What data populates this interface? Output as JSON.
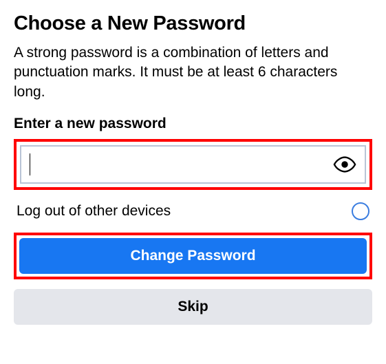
{
  "header": {
    "title": "Choose a New Password",
    "description": "A strong password is a combination of letters and punctuation marks. It must be at least 6 characters long."
  },
  "form": {
    "passwordLabel": "Enter a new password",
    "passwordValue": "",
    "logoutOthersLabel": "Log out of other devices",
    "logoutOthersChecked": false
  },
  "buttons": {
    "primary": "Change Password",
    "secondary": "Skip"
  }
}
